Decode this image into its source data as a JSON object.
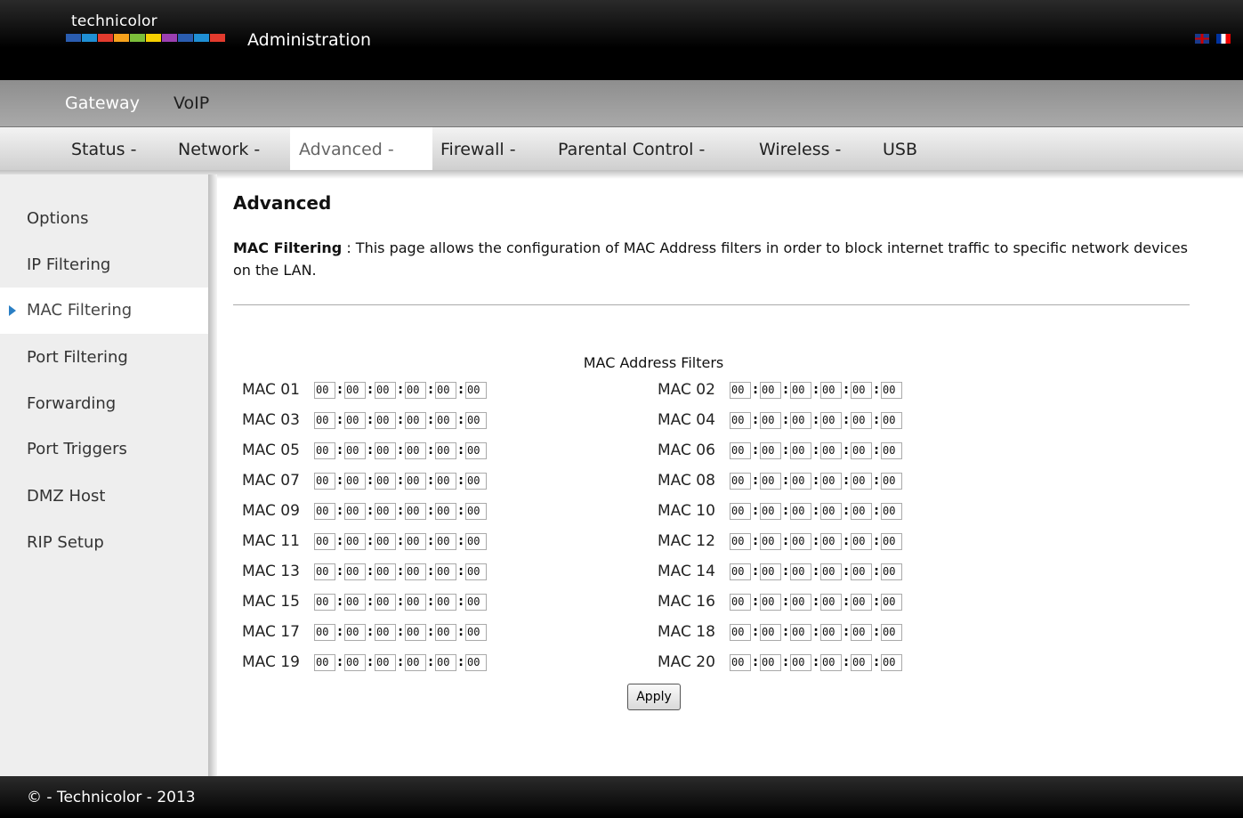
{
  "brand": {
    "logo_text": "technicolor",
    "logo_colors": [
      "#2a5db0",
      "#1f8fd4",
      "#e33b2e",
      "#f6a21c",
      "#7cbf3a",
      "#f5d000",
      "#9b3fb0",
      "#2a5db0",
      "#1f8fd4",
      "#e33b2e"
    ]
  },
  "header": {
    "title": "Administration",
    "languages": [
      "uk-flag-icon",
      "fr-flag-icon"
    ]
  },
  "nav_primary": [
    {
      "label": "Gateway"
    },
    {
      "label": "VoIP"
    }
  ],
  "nav_secondary": [
    {
      "label": "Status -"
    },
    {
      "label": "Network -"
    },
    {
      "label": "Advanced -"
    },
    {
      "label": "Firewall -"
    },
    {
      "label": "Parental Control -"
    },
    {
      "label": "Wireless -"
    },
    {
      "label": "USB"
    }
  ],
  "sidebar": {
    "items": [
      {
        "label": "Options"
      },
      {
        "label": "IP Filtering"
      },
      {
        "label": "MAC Filtering"
      },
      {
        "label": "Port Filtering"
      },
      {
        "label": "Forwarding"
      },
      {
        "label": "Port Triggers"
      },
      {
        "label": "DMZ Host"
      },
      {
        "label": "RIP Setup"
      }
    ],
    "active": "MAC Filtering"
  },
  "main": {
    "title": "Advanced",
    "description_label": "MAC Filtering",
    "description_sep": " : ",
    "description_text": "This page allows the configuration of MAC Address filters in order to block internet traffic to specific network devices on the LAN.",
    "filters_title": "MAC Address Filters",
    "macs": [
      {
        "label": "MAC 01",
        "octets": [
          "00",
          "00",
          "00",
          "00",
          "00",
          "00"
        ]
      },
      {
        "label": "MAC 02",
        "octets": [
          "00",
          "00",
          "00",
          "00",
          "00",
          "00"
        ]
      },
      {
        "label": "MAC 03",
        "octets": [
          "00",
          "00",
          "00",
          "00",
          "00",
          "00"
        ]
      },
      {
        "label": "MAC 04",
        "octets": [
          "00",
          "00",
          "00",
          "00",
          "00",
          "00"
        ]
      },
      {
        "label": "MAC 05",
        "octets": [
          "00",
          "00",
          "00",
          "00",
          "00",
          "00"
        ]
      },
      {
        "label": "MAC 06",
        "octets": [
          "00",
          "00",
          "00",
          "00",
          "00",
          "00"
        ]
      },
      {
        "label": "MAC 07",
        "octets": [
          "00",
          "00",
          "00",
          "00",
          "00",
          "00"
        ]
      },
      {
        "label": "MAC 08",
        "octets": [
          "00",
          "00",
          "00",
          "00",
          "00",
          "00"
        ]
      },
      {
        "label": "MAC 09",
        "octets": [
          "00",
          "00",
          "00",
          "00",
          "00",
          "00"
        ]
      },
      {
        "label": "MAC 10",
        "octets": [
          "00",
          "00",
          "00",
          "00",
          "00",
          "00"
        ]
      },
      {
        "label": "MAC 11",
        "octets": [
          "00",
          "00",
          "00",
          "00",
          "00",
          "00"
        ]
      },
      {
        "label": "MAC 12",
        "octets": [
          "00",
          "00",
          "00",
          "00",
          "00",
          "00"
        ]
      },
      {
        "label": "MAC 13",
        "octets": [
          "00",
          "00",
          "00",
          "00",
          "00",
          "00"
        ]
      },
      {
        "label": "MAC 14",
        "octets": [
          "00",
          "00",
          "00",
          "00",
          "00",
          "00"
        ]
      },
      {
        "label": "MAC 15",
        "octets": [
          "00",
          "00",
          "00",
          "00",
          "00",
          "00"
        ]
      },
      {
        "label": "MAC 16",
        "octets": [
          "00",
          "00",
          "00",
          "00",
          "00",
          "00"
        ]
      },
      {
        "label": "MAC 17",
        "octets": [
          "00",
          "00",
          "00",
          "00",
          "00",
          "00"
        ]
      },
      {
        "label": "MAC 18",
        "octets": [
          "00",
          "00",
          "00",
          "00",
          "00",
          "00"
        ]
      },
      {
        "label": "MAC 19",
        "octets": [
          "00",
          "00",
          "00",
          "00",
          "00",
          "00"
        ]
      },
      {
        "label": "MAC 20",
        "octets": [
          "00",
          "00",
          "00",
          "00",
          "00",
          "00"
        ]
      }
    ],
    "octet_separator": ":",
    "apply_label": "Apply"
  },
  "footer": {
    "text": "© - Technicolor - 2013"
  }
}
